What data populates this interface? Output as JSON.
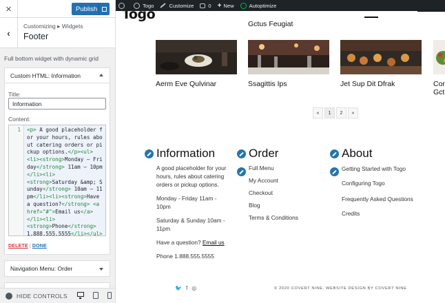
{
  "customizer": {
    "publish_label": "Publish",
    "breadcrumb_root": "Customizing",
    "breadcrumb_sep": "▸",
    "breadcrumb_parent": "Widgets",
    "section_title": "Footer",
    "section_description": "Full bottom widget with dynamic grid",
    "widget": {
      "title": "Custom HTML: Information",
      "title_label": "Title:",
      "title_value": "Information",
      "content_label": "Content:",
      "line_number": "1",
      "code": [
        {
          "t": "tag",
          "v": "<p>"
        },
        {
          "t": "txt",
          "v": " A good placeholder for your hours, rules about catering orders or pickup options."
        },
        {
          "t": "tag",
          "v": "</p><ul>"
        },
        {
          "t": "txt",
          "v": "\n"
        },
        {
          "t": "tag",
          "v": "<li><strong>"
        },
        {
          "t": "txt",
          "v": "Monday – Friday"
        },
        {
          "t": "tag",
          "v": "</strong>"
        },
        {
          "t": "txt",
          "v": " 11am – 10pm"
        },
        {
          "t": "tag",
          "v": "</li><li>"
        },
        {
          "t": "txt",
          "v": "\n"
        },
        {
          "t": "tag",
          "v": "<strong>"
        },
        {
          "t": "txt",
          "v": "Saturday &amp; Sunday"
        },
        {
          "t": "tag",
          "v": "</strong>"
        },
        {
          "t": "txt",
          "v": " 10am – 11pm"
        },
        {
          "t": "tag",
          "v": "</li><li><strong>"
        },
        {
          "t": "txt",
          "v": "Have a question?"
        },
        {
          "t": "tag",
          "v": "</strong> <a href=\"#\">"
        },
        {
          "t": "txt",
          "v": "Email us"
        },
        {
          "t": "tag",
          "v": "</a>"
        },
        {
          "t": "txt",
          "v": "\n"
        },
        {
          "t": "tag",
          "v": "</li><li>"
        },
        {
          "t": "txt",
          "v": "\n"
        },
        {
          "t": "tag",
          "v": "<strong>"
        },
        {
          "t": "txt",
          "v": "Phone"
        },
        {
          "t": "tag",
          "v": "</strong>"
        },
        {
          "t": "txt",
          "v": "\n1.888.555.5555"
        },
        {
          "t": "tag",
          "v": "</li></ul>"
        }
      ],
      "delete_label": "DELETE",
      "action_sep": "|",
      "done_label": "DONE"
    },
    "widget2_title": "Navigation Menu: Order",
    "hide_controls_label": "HIDE CONTROLS"
  },
  "adminbar": {
    "site_name": "Togo",
    "customize": "Customize",
    "comments": "0",
    "new": "New",
    "autoptimize": "Autoptimize"
  },
  "preview": {
    "logo": "Togo",
    "featured_title": "Gctus Feugiat",
    "cards": [
      {
        "title": "Aerm Eve Qulvinar"
      },
      {
        "title": "Ssagittis Ips"
      },
      {
        "title": "Jet Sup Dit Dfrak"
      },
      {
        "title": "Con Gctu"
      }
    ],
    "pager": [
      "«",
      "1",
      "2",
      "»"
    ],
    "columns": {
      "information": {
        "title": "Information",
        "intro": "A good placeholder for your hours, rules about catering orders or pickup options.",
        "weekday": "Monday - Friday 11am - 10pm",
        "weekend": "Saturday & Sunday 10am - 11pm",
        "question": "Have a question?",
        "email": "Email us",
        "phone": "Phone 1.888.555.5555"
      },
      "order": {
        "title": "Order",
        "links": [
          "Full Menu",
          "My Account",
          "Checkout",
          "Blog",
          "Terms & Conditions"
        ]
      },
      "about": {
        "title": "About",
        "links": [
          "Getting Started with Togo",
          "Configuring Togo",
          "Frequently Asked Questions",
          "Credits"
        ]
      }
    },
    "social_icons": [
      "twitter-icon",
      "facebook-icon",
      "instagram-icon"
    ],
    "social_glyphs": [
      "🐦",
      "f",
      "◎"
    ],
    "copyright": "© 2020 COVERT NINE. WEBSITE DESIGN BY COVERT NINE"
  },
  "colors": {
    "publish": "#2271b1",
    "pen_icon": "#2676aa",
    "code_tag": "#22863a",
    "adminbar": "#1d2327"
  }
}
